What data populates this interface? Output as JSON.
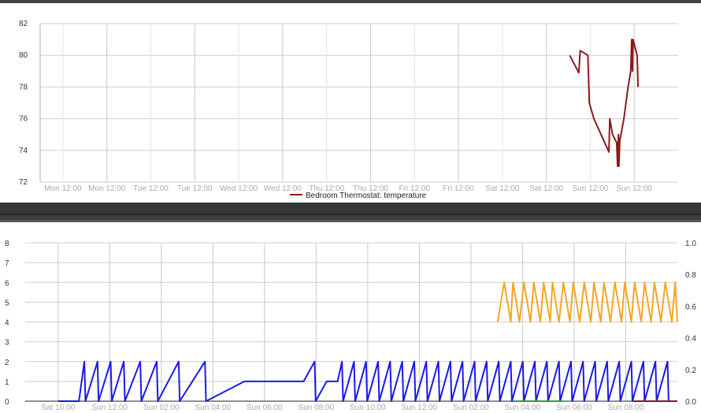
{
  "chart_data": [
    {
      "type": "line",
      "title": "",
      "ylim": [
        72,
        82
      ],
      "y_ticks": [
        "72",
        "74",
        "76",
        "78",
        "80",
        "82"
      ],
      "x_ticks": [
        "Mon 12:00",
        "Mon 12:00",
        "Tue 12:00",
        "Tue 12:00",
        "Wed 12:00",
        "Wed 12:00",
        "Thu 12:00",
        "Thu 12:00",
        "Fri 12:00",
        "Fri 12:00",
        "Sat 12:00",
        "Sat 12:00",
        "Sun 12:00",
        "Sun 12:00"
      ],
      "x_range": [
        0,
        14
      ],
      "grid": true,
      "legend_position": "bottom",
      "series": [
        {
          "name": "Bedroom Thermostat: temperature",
          "color": "#8b1a1a",
          "points": [
            [
              11.62,
              80
            ],
            [
              11.82,
              78.9
            ],
            [
              11.85,
              80.3
            ],
            [
              12.02,
              80
            ],
            [
              12.05,
              77
            ],
            [
              12.15,
              76
            ],
            [
              12.48,
              73.9
            ],
            [
              12.5,
              76
            ],
            [
              12.56,
              75
            ],
            [
              12.65,
              74.5
            ],
            [
              12.67,
              73
            ],
            [
              12.69,
              75
            ],
            [
              12.7,
              73
            ],
            [
              12.72,
              74.6
            ],
            [
              12.81,
              76
            ],
            [
              12.9,
              78
            ],
            [
              12.96,
              79
            ],
            [
              12.98,
              81
            ],
            [
              13.0,
              79
            ],
            [
              13.01,
              81
            ],
            [
              13.1,
              80
            ],
            [
              13.12,
              78
            ]
          ]
        }
      ]
    },
    {
      "type": "line",
      "title": "",
      "ylim": [
        0,
        8
      ],
      "y2lim": [
        0,
        1
      ],
      "y_ticks": [
        "0",
        "1",
        "2",
        "3",
        "4",
        "5",
        "6",
        "7",
        "8"
      ],
      "y2_ticks": [
        "0.0",
        "0.2",
        "0.4",
        "0.6",
        "0.8",
        "1.0"
      ],
      "x_ticks": [
        "Sat 10:00",
        "Sun 12:00",
        "Sun 02:00",
        "Sun 04:00",
        "Sun 06:00",
        "Sun 08:00",
        "Sun 10:00",
        "Sun 12:00",
        "Sun 02:00",
        "Sun 04:00",
        "Sun 06:00",
        "Sun 08:00"
      ],
      "x_range": [
        -0.6,
        11.3
      ],
      "grid": true,
      "series": [
        {
          "color": "#1a1ae6",
          "points": [
            [
              0,
              0
            ],
            [
              0.38,
              0
            ],
            [
              0.48,
              2
            ],
            [
              0.5,
              0
            ],
            [
              0.72,
              2
            ],
            [
              0.74,
              0
            ],
            [
              0.96,
              2
            ],
            [
              0.98,
              0
            ],
            [
              1.2,
              2
            ],
            [
              1.22,
              0
            ],
            [
              1.5,
              2
            ],
            [
              1.52,
              0
            ],
            [
              1.8,
              2
            ],
            [
              1.82,
              0
            ],
            [
              2.2,
              2
            ],
            [
              2.22,
              0
            ],
            [
              2.68,
              2
            ],
            [
              2.7,
              0
            ],
            [
              3.4,
              1
            ],
            [
              3.6,
              1
            ],
            [
              3.9,
              1
            ],
            [
              4.3,
              1
            ],
            [
              4.48,
              1
            ],
            [
              4.68,
              2
            ],
            [
              4.7,
              0
            ],
            [
              4.9,
              1
            ],
            [
              5.1,
              1
            ],
            [
              5.18,
              2
            ],
            [
              5.2,
              0
            ],
            [
              5.4,
              2
            ],
            [
              5.42,
              0
            ],
            [
              5.62,
              2
            ],
            [
              5.64,
              0
            ],
            [
              5.84,
              2
            ],
            [
              5.86,
              0
            ],
            [
              6.06,
              2
            ],
            [
              6.08,
              0
            ],
            [
              6.28,
              2
            ],
            [
              6.3,
              0
            ],
            [
              6.5,
              2
            ],
            [
              6.52,
              0
            ],
            [
              6.72,
              2
            ],
            [
              6.74,
              0
            ],
            [
              6.94,
              2
            ],
            [
              6.96,
              0
            ],
            [
              7.16,
              2
            ],
            [
              7.18,
              0
            ],
            [
              7.38,
              2
            ],
            [
              7.4,
              0
            ],
            [
              7.6,
              2
            ],
            [
              7.62,
              0
            ],
            [
              7.82,
              2
            ],
            [
              7.84,
              0
            ],
            [
              8.04,
              2
            ],
            [
              8.06,
              0
            ],
            [
              8.26,
              2
            ],
            [
              8.28,
              0
            ],
            [
              8.48,
              2
            ],
            [
              8.5,
              0
            ],
            [
              8.7,
              2
            ],
            [
              8.72,
              0
            ],
            [
              8.92,
              2
            ],
            [
              8.94,
              0
            ],
            [
              9.14,
              2
            ],
            [
              9.16,
              0
            ],
            [
              9.36,
              2
            ],
            [
              9.38,
              0
            ],
            [
              9.58,
              2
            ],
            [
              9.6,
              0
            ],
            [
              9.8,
              2
            ],
            [
              9.82,
              0
            ],
            [
              10.02,
              2
            ],
            [
              10.04,
              0
            ],
            [
              10.24,
              2
            ],
            [
              10.26,
              0
            ],
            [
              10.46,
              2
            ],
            [
              10.48,
              0
            ],
            [
              10.68,
              2
            ],
            [
              10.7,
              0
            ],
            [
              10.9,
              2
            ],
            [
              10.92,
              0
            ],
            [
              11.12,
              2
            ],
            [
              11.14,
              0
            ],
            [
              11.3,
              0
            ]
          ],
          "zero_segments": [
            [
              -0.6,
              0.38
            ],
            [
              8.1,
              8.3
            ],
            [
              8.36,
              8.5
            ],
            [
              9.2,
              9.32
            ],
            [
              9.4,
              9.56
            ],
            [
              10.1,
              10.3
            ],
            [
              10.46,
              10.6
            ],
            [
              10.8,
              11.0
            ]
          ]
        },
        {
          "color": "#f5a623",
          "points": [
            [
              8.02,
              4
            ],
            [
              8.14,
              6
            ],
            [
              8.26,
              4
            ],
            [
              8.3,
              6
            ],
            [
              8.42,
              4
            ],
            [
              8.5,
              6
            ],
            [
              8.62,
              4
            ],
            [
              8.68,
              6
            ],
            [
              8.8,
              4
            ],
            [
              8.86,
              6
            ],
            [
              8.98,
              4
            ],
            [
              9.02,
              6
            ],
            [
              9.14,
              4
            ],
            [
              9.22,
              6
            ],
            [
              9.34,
              4
            ],
            [
              9.4,
              6
            ],
            [
              9.52,
              4
            ],
            [
              9.6,
              6
            ],
            [
              9.72,
              4
            ],
            [
              9.78,
              6
            ],
            [
              9.9,
              4
            ],
            [
              9.96,
              6
            ],
            [
              10.08,
              4
            ],
            [
              10.16,
              6
            ],
            [
              10.28,
              4
            ],
            [
              10.34,
              6
            ],
            [
              10.46,
              4
            ],
            [
              10.52,
              6
            ],
            [
              10.64,
              4
            ],
            [
              10.7,
              6
            ],
            [
              10.82,
              4
            ],
            [
              10.88,
              6
            ],
            [
              11.0,
              4
            ],
            [
              11.08,
              6
            ],
            [
              11.2,
              4
            ],
            [
              11.26,
              6
            ],
            [
              11.3,
              4
            ]
          ]
        },
        {
          "color": "#2e9e2e",
          "points": [
            [
              8.3,
              0
            ],
            [
              9.2,
              0
            ]
          ]
        },
        {
          "color": "#8b1a1a",
          "points": [
            [
              10.5,
              0
            ],
            [
              11.3,
              0
            ]
          ]
        }
      ]
    }
  ]
}
